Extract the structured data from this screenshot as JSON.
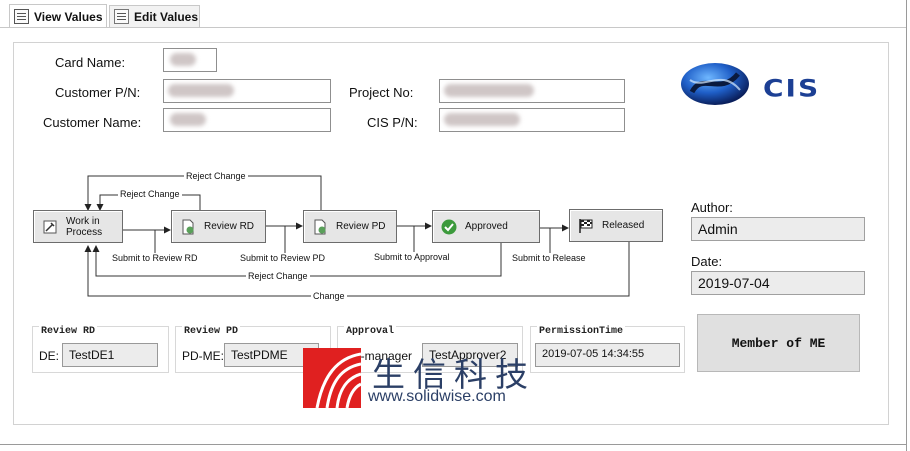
{
  "tabs": [
    {
      "label": "View Values",
      "active": true
    },
    {
      "label": "Edit Values",
      "active": false
    }
  ],
  "form": {
    "card_name_label": "Card Name:",
    "customer_pn_label": "Customer P/N:",
    "customer_name_label": "Customer Name:",
    "project_no_label": "Project No:",
    "cis_pn_label": "CIS P/N:",
    "card_name_value": "",
    "customer_pn_value": "",
    "customer_name_value": "",
    "project_no_value": "",
    "cis_pn_value": ""
  },
  "brand": {
    "logo_text": "CIS",
    "color": "#1c3f94"
  },
  "workflow": {
    "states": [
      {
        "label": "Work in Process",
        "icon": "wrench-icon"
      },
      {
        "label": "Review RD",
        "icon": "document-check-icon"
      },
      {
        "label": "Review PD",
        "icon": "document-check-icon"
      },
      {
        "label": "Approved",
        "icon": "check-circle-icon"
      },
      {
        "label": "Released",
        "icon": "checkered-flag-icon"
      }
    ],
    "transitions": {
      "submit_rd": "Submit to Review RD",
      "submit_pd": "Submit to Review PD",
      "submit_approval": "Submit to Approval",
      "submit_release": "Submit to Release",
      "reject_top_outer": "Reject Change",
      "reject_top_inner": "Reject Change",
      "reject_bottom": "Reject Change",
      "change": "Change"
    }
  },
  "author": {
    "label": "Author:",
    "value": "Admin"
  },
  "date": {
    "label": "Date:",
    "value": "2019-07-04"
  },
  "groups": [
    {
      "title": "Review RD",
      "field_label": "DE:",
      "value": "TestDE1"
    },
    {
      "title": "Review PD",
      "field_label": "PD-ME:",
      "value": "TestPDME"
    },
    {
      "title": "Approval",
      "field_label": "PD-manager",
      "value": "TestApprover2"
    },
    {
      "title": "PermissionTime",
      "field_label": "",
      "value": "2019-07-05 14:34:55"
    }
  ],
  "member_button": "Member of ME",
  "watermark": {
    "cn": "生信科技",
    "url": "www.solidwise.com",
    "color": "#e02020"
  }
}
